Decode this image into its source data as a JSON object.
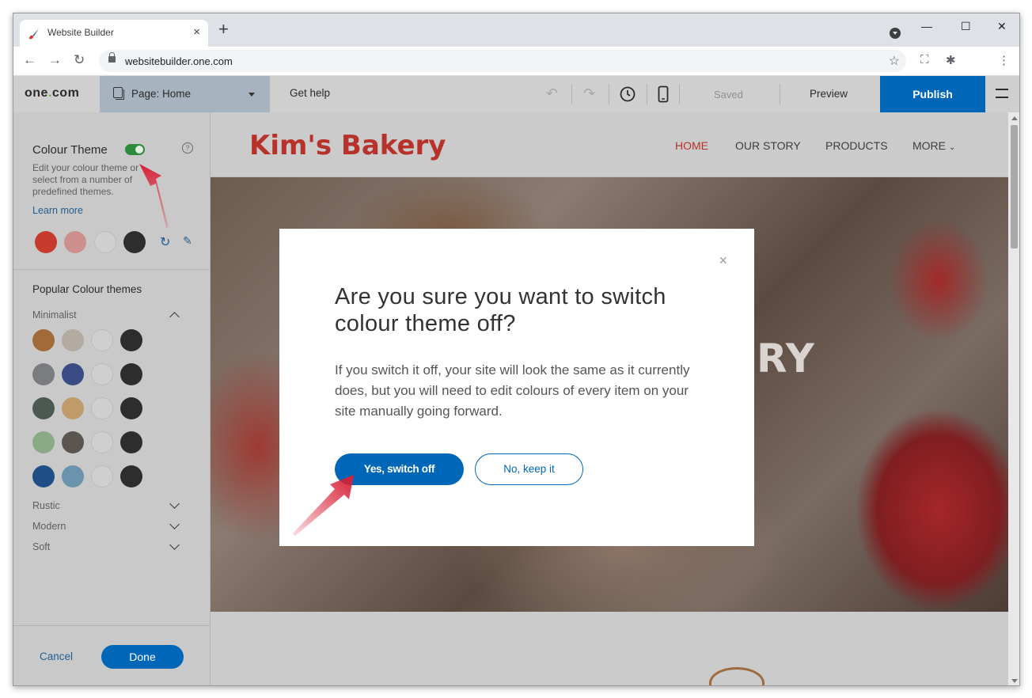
{
  "browser": {
    "tab_title": "Website Builder",
    "tab_close": "×",
    "new_tab": "+",
    "url": "websitebuilder.one.com",
    "controls": {
      "minimize": "—",
      "maximize": "☐",
      "close": "✕"
    }
  },
  "app_header": {
    "logo_prefix": "one",
    "logo_dot": ".",
    "logo_suffix": "com",
    "page_label": "Page:",
    "page_value": "Home",
    "get_help": "Get help",
    "saved": "Saved",
    "preview": "Preview",
    "publish": "Publish"
  },
  "sidebar": {
    "title": "Colour Theme",
    "toggle_on": true,
    "help": "?",
    "description": "Edit your colour theme or select from a number of predefined themes.",
    "learn_more": "Learn more",
    "current_theme": [
      "#c8392e",
      "#cc8f8b",
      "#cfcfcf",
      "#2d2d2d"
    ],
    "popular_title": "Popular Colour themes",
    "groups": [
      {
        "name": "Minimalist",
        "expanded": true,
        "themes": [
          [
            "#a06a3a",
            "#b3aaa2",
            "#cfcfcf",
            "#2d2d2d"
          ],
          [
            "#7a7c80",
            "#3b4b86",
            "#cfcfcf",
            "#2d2d2d"
          ],
          [
            "#4c5852",
            "#c19b6a",
            "#cfcfcf",
            "#2d2d2d"
          ],
          [
            "#8aaa85",
            "#5a554e",
            "#cfcfcf",
            "#2d2d2d"
          ],
          [
            "#1f4f86",
            "#6a93ad",
            "#cfcfcf",
            "#2d2d2d"
          ]
        ]
      },
      {
        "name": "Rustic",
        "expanded": false
      },
      {
        "name": "Modern",
        "expanded": false
      },
      {
        "name": "Soft",
        "expanded": false
      }
    ],
    "cancel": "Cancel",
    "done": "Done"
  },
  "site": {
    "title": "Kim's Bakery",
    "nav": [
      "HOME",
      "OUR STORY",
      "PRODUCTS",
      "MORE"
    ],
    "hero_text": "RY"
  },
  "modal": {
    "close": "×",
    "heading": "Are you sure you want to switch colour theme off?",
    "body": "If you switch it off, your site will look the same as it currently does, but you will need to edit colours of every item on your site manually going forward.",
    "confirm": "Yes, switch off",
    "reject": "No, keep it"
  },
  "colors": {
    "accent": "#0067b8",
    "site_title": "#b8322c",
    "toggle": "#2e8b3d",
    "annotation_arrow": "#d91f35"
  }
}
